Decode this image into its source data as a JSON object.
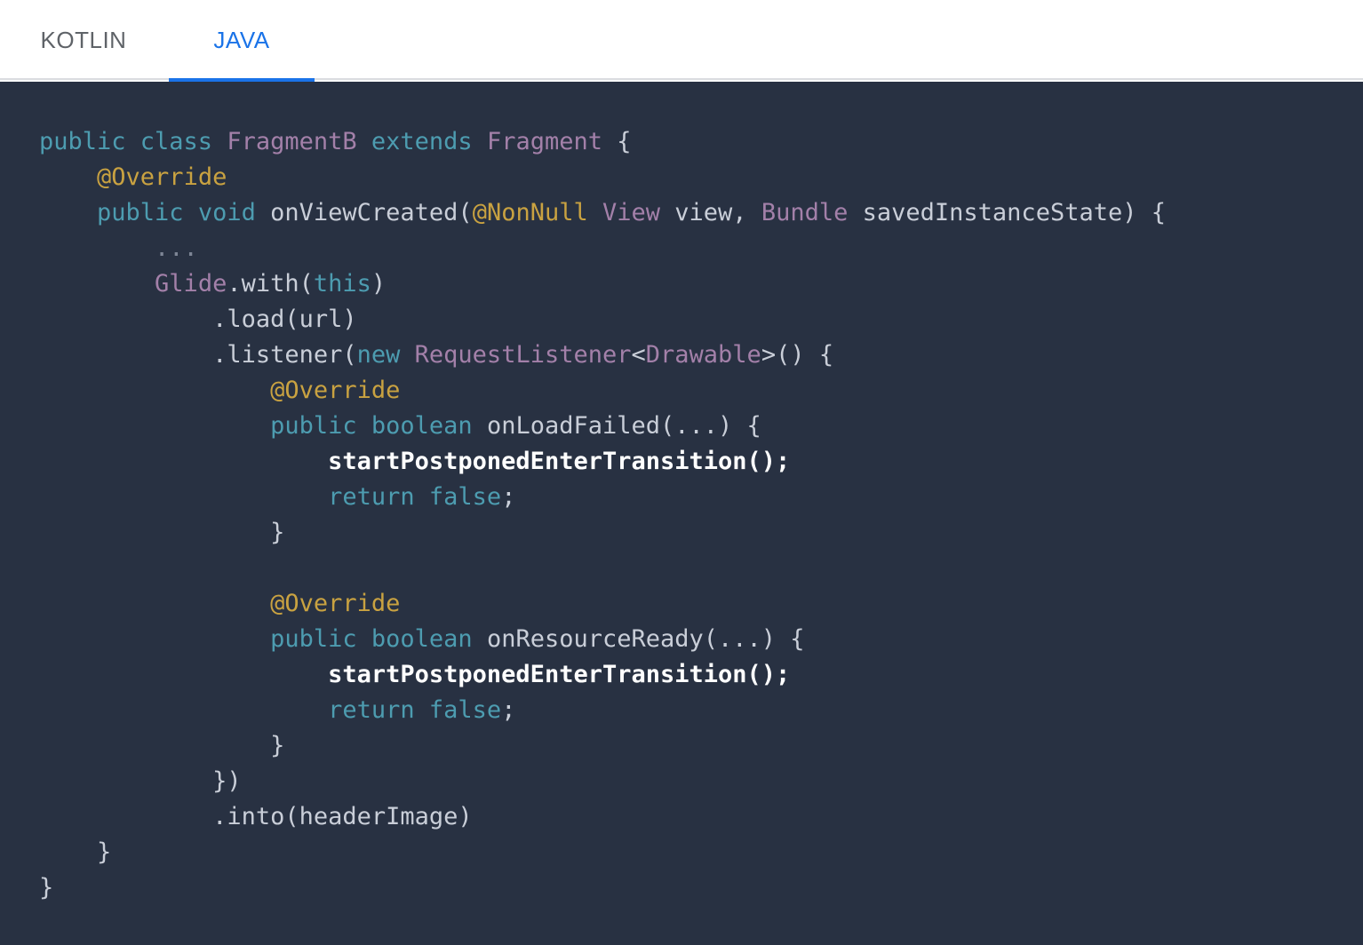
{
  "tabs": [
    {
      "label": "KOTLIN",
      "selected": false
    },
    {
      "label": "JAVA",
      "selected": true
    }
  ],
  "colors": {
    "accent": "#1a73e8",
    "code_background": "#283142",
    "keyword": "#4d9cb0",
    "type": "#a380a9",
    "annotation": "#c9a241",
    "plain": "#c9ced8",
    "highlight": "#ffffff"
  },
  "code": {
    "language": "java",
    "lines": [
      [
        {
          "t": "kw",
          "v": "public class "
        },
        {
          "t": "ty",
          "v": "FragmentB "
        },
        {
          "t": "kw",
          "v": "extends "
        },
        {
          "t": "ty",
          "v": "Fragment "
        },
        {
          "t": "pl",
          "v": "{"
        }
      ],
      [
        {
          "t": "pl",
          "v": "    "
        },
        {
          "t": "an",
          "v": "@Override"
        }
      ],
      [
        {
          "t": "pl",
          "v": "    "
        },
        {
          "t": "kw",
          "v": "public void "
        },
        {
          "t": "pl",
          "v": "onViewCreated("
        },
        {
          "t": "an",
          "v": "@NonNull "
        },
        {
          "t": "ty",
          "v": "View "
        },
        {
          "t": "pl",
          "v": "view, "
        },
        {
          "t": "ty",
          "v": "Bundle "
        },
        {
          "t": "pl",
          "v": "savedInstanceState) {"
        }
      ],
      [
        {
          "t": "cm",
          "v": "        ..."
        }
      ],
      [
        {
          "t": "pl",
          "v": "        "
        },
        {
          "t": "ty",
          "v": "Glide"
        },
        {
          "t": "pl",
          "v": ".with("
        },
        {
          "t": "kw",
          "v": "this"
        },
        {
          "t": "pl",
          "v": ")"
        }
      ],
      [
        {
          "t": "pl",
          "v": "            .load(url)"
        }
      ],
      [
        {
          "t": "pl",
          "v": "            .listener("
        },
        {
          "t": "kw",
          "v": "new "
        },
        {
          "t": "ty",
          "v": "RequestListener"
        },
        {
          "t": "pl",
          "v": "<"
        },
        {
          "t": "ty",
          "v": "Drawable"
        },
        {
          "t": "pl",
          "v": ">() {"
        }
      ],
      [
        {
          "t": "pl",
          "v": "                "
        },
        {
          "t": "an",
          "v": "@Override"
        }
      ],
      [
        {
          "t": "pl",
          "v": "                "
        },
        {
          "t": "kw",
          "v": "public boolean "
        },
        {
          "t": "pl",
          "v": "onLoadFailed(...) {"
        }
      ],
      [
        {
          "t": "pl",
          "v": "                    "
        },
        {
          "t": "hl",
          "v": "startPostponedEnterTransition();"
        }
      ],
      [
        {
          "t": "pl",
          "v": "                    "
        },
        {
          "t": "kw",
          "v": "return false"
        },
        {
          "t": "pl",
          "v": ";"
        }
      ],
      [
        {
          "t": "pl",
          "v": "                }"
        }
      ],
      [
        {
          "t": "pl",
          "v": ""
        }
      ],
      [
        {
          "t": "pl",
          "v": "                "
        },
        {
          "t": "an",
          "v": "@Override"
        }
      ],
      [
        {
          "t": "pl",
          "v": "                "
        },
        {
          "t": "kw",
          "v": "public boolean "
        },
        {
          "t": "pl",
          "v": "onResourceReady(...) {"
        }
      ],
      [
        {
          "t": "pl",
          "v": "                    "
        },
        {
          "t": "hl",
          "v": "startPostponedEnterTransition();"
        }
      ],
      [
        {
          "t": "pl",
          "v": "                    "
        },
        {
          "t": "kw",
          "v": "return false"
        },
        {
          "t": "pl",
          "v": ";"
        }
      ],
      [
        {
          "t": "pl",
          "v": "                }"
        }
      ],
      [
        {
          "t": "pl",
          "v": "            })"
        }
      ],
      [
        {
          "t": "pl",
          "v": "            .into(headerImage)"
        }
      ],
      [
        {
          "t": "pl",
          "v": "    }"
        }
      ],
      [
        {
          "t": "pl",
          "v": "}"
        }
      ]
    ]
  }
}
